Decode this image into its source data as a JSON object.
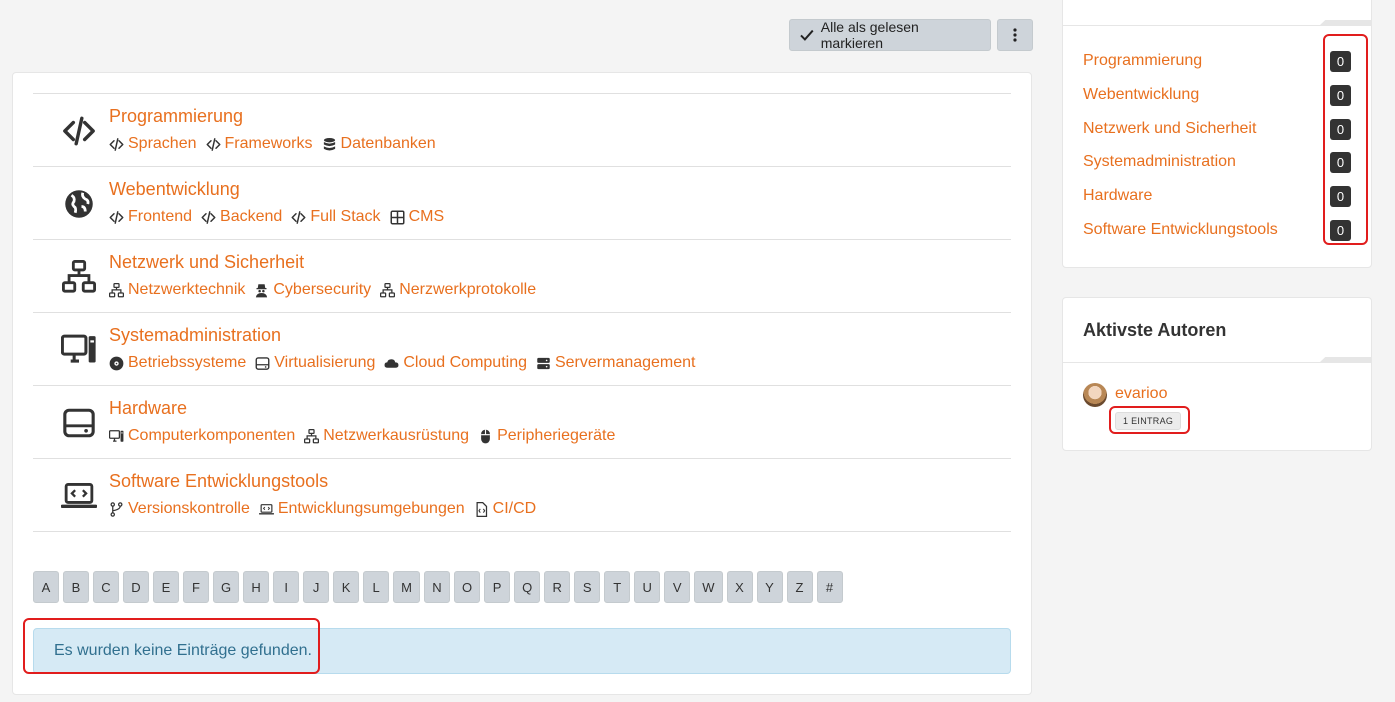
{
  "toolbar": {
    "mark_all_read": "Alle als gelesen markieren"
  },
  "categories": [
    {
      "title": "Programmierung",
      "icon": "code-icon",
      "subs": [
        {
          "label": "Sprachen",
          "icon": "code-icon"
        },
        {
          "label": "Frameworks",
          "icon": "code-icon"
        },
        {
          "label": "Datenbanken",
          "icon": "database-icon"
        }
      ]
    },
    {
      "title": "Webentwicklung",
      "icon": "globe-icon",
      "subs": [
        {
          "label": "Frontend",
          "icon": "code-icon"
        },
        {
          "label": "Backend",
          "icon": "code-icon"
        },
        {
          "label": "Full Stack",
          "icon": "code-icon"
        },
        {
          "label": "CMS",
          "icon": "grid-icon"
        }
      ]
    },
    {
      "title": "Netzwerk und Sicherheit",
      "icon": "network-icon",
      "subs": [
        {
          "label": "Netzwerktechnik",
          "icon": "network-icon"
        },
        {
          "label": "Cybersecurity",
          "icon": "user-secret-icon"
        },
        {
          "label": "Nerzwerkprotokolle",
          "icon": "network-icon"
        }
      ]
    },
    {
      "title": "Systemadministration",
      "icon": "desktop-icon",
      "subs": [
        {
          "label": "Betriebssysteme",
          "icon": "disc-icon"
        },
        {
          "label": "Virtualisierung",
          "icon": "hdd-icon"
        },
        {
          "label": "Cloud Computing",
          "icon": "cloud-icon"
        },
        {
          "label": "Servermanagement",
          "icon": "server-icon"
        }
      ]
    },
    {
      "title": "Hardware",
      "icon": "hdd-icon",
      "subs": [
        {
          "label": "Computerkomponenten",
          "icon": "desktop-icon"
        },
        {
          "label": "Netzwerkausrüstung",
          "icon": "network-icon"
        },
        {
          "label": "Peripheriegeräte",
          "icon": "mouse-icon"
        }
      ]
    },
    {
      "title": "Software Entwicklungstools",
      "icon": "laptop-code-icon",
      "subs": [
        {
          "label": "Versionskontrolle",
          "icon": "branch-icon"
        },
        {
          "label": "Entwicklungsumgebungen",
          "icon": "laptop-code-icon"
        },
        {
          "label": "CI/CD",
          "icon": "file-code-icon"
        }
      ]
    }
  ],
  "letters": [
    "A",
    "B",
    "C",
    "D",
    "E",
    "F",
    "G",
    "H",
    "I",
    "J",
    "K",
    "L",
    "M",
    "N",
    "O",
    "P",
    "Q",
    "R",
    "S",
    "T",
    "U",
    "V",
    "W",
    "X",
    "Y",
    "Z",
    "#"
  ],
  "alert": {
    "text": "Es wurden keine Einträge gefunden."
  },
  "sidebar": {
    "categories": [
      {
        "label": "Programmierung",
        "count": "0"
      },
      {
        "label": "Webentwicklung",
        "count": "0"
      },
      {
        "label": "Netzwerk und Sicherheit",
        "count": "0"
      },
      {
        "label": "Systemadministration",
        "count": "0"
      },
      {
        "label": "Hardware",
        "count": "0"
      },
      {
        "label": "Software Entwicklungstools",
        "count": "0"
      }
    ],
    "authors_title": "Aktivste Autoren",
    "authors": [
      {
        "name": "evarioo",
        "entries": "1 EINTRAG"
      }
    ]
  },
  "colors": {
    "accent": "#e8701f",
    "badge": "#333333",
    "alert_bg": "#d6eaf5",
    "highlight": "#e11d1d"
  }
}
